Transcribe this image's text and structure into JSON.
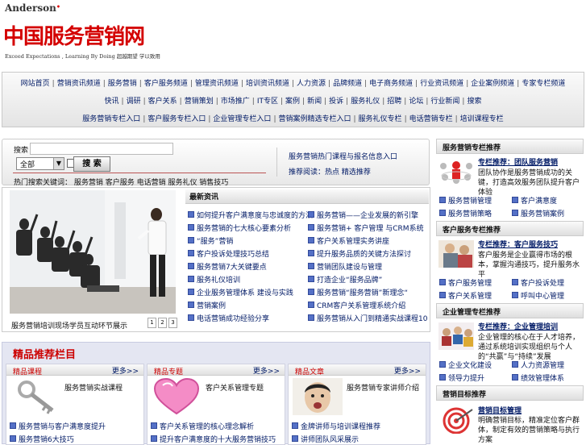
{
  "brand": {
    "en": "Anderson",
    "reg_mark": "•",
    "cn": "中国服务营销网",
    "tagline": "Exceed Expectations , Learning By Doing 超越期望 学以致用"
  },
  "nav": {
    "row1": [
      "网站首页",
      "营销资讯频道",
      "服务营销",
      "客户服务频道",
      "管理资讯频道",
      "培训资讯频道",
      "人力资源",
      "品牌频道",
      "电子商务频道",
      "行业资讯频道",
      "企业案例频道",
      "专家专栏频道"
    ],
    "row2": [
      "快讯",
      "调研",
      "客户关系",
      "营销策划",
      "市场推广",
      "IT专区",
      "案例",
      "新闻",
      "投诉",
      "服务礼仪",
      "招聘",
      "论坛",
      "行业新闻",
      "搜索"
    ],
    "row3": [
      "服务营销专栏入口",
      "客户服务专栏入口",
      "企业管理专栏入口",
      "营销案例精选专栏入口",
      "服务礼仪专栏",
      "电话营销专栏",
      "培训课程专栏"
    ]
  },
  "search": {
    "label": "搜索",
    "input_value": "",
    "select_value": "全部",
    "button": "搜 索",
    "link1": "服务营销热门课程与报名信息入口",
    "link2": "推荐阅读：热点 精选推荐"
  },
  "hot_line": "热门搜索关键词： 服务营销 客户服务 电话营销 服务礼仪 销售技巧",
  "news": {
    "title": "最新资讯",
    "photo_caption": "服务营销培训现场学员互动环节展示",
    "pages": [
      "1",
      "2",
      "3"
    ],
    "left": [
      "如何提升客户满意度与忠诚度的方法",
      "服务营销的七大核心要素分析",
      "“服务”营销",
      "客户投诉处理技巧总结",
      "服务营销7大关键要点",
      "服务礼仪培训",
      "企业服务管理体系 建设与实践",
      "营销案例",
      "电话营销成功经验分享"
    ],
    "right": [
      "服务营销——企业发展的新引擎",
      "服务营销+ 客户管理 与CRM系统",
      "客户关系管理实务讲座",
      "提升服务品质的关键方法探讨",
      "营销团队建设与管理",
      "打造企业“服务品牌”",
      "服务营销“服务营销”新理念“",
      "CRM客户关系管理系统介绍",
      "服务营销从入门到精通实战课程10"
    ]
  },
  "featured": {
    "title": "精品推荐栏目",
    "more": "更多>>",
    "cards": [
      {
        "tag": "精品课程",
        "desc": "服务营销实战课程",
        "l1": "服务营销与客户满意度提升",
        "l2": "服务营销6大技巧"
      },
      {
        "tag": "精品专题",
        "desc": "客户关系管理专题",
        "l1": "客户关系管理的核心理念解析",
        "l2": "提升客户满意度的十大服务营销技巧"
      },
      {
        "tag": "精品文章",
        "desc": "服务营销专家讲师介绍",
        "l1": "金牌讲师与培训课程推荐",
        "l2": "讲师团队风采展示"
      }
    ]
  },
  "right_boxes": [
    {
      "head": "服务营销专栏推荐",
      "title": "专栏推荐：团队服务营销",
      "desc": "团队协作是服务营销成功的关键，打造高效服务团队提升客户体验",
      "links": [
        "服务营销管理",
        "客户满意度",
        "服务营销策略",
        "服务营销案例"
      ]
    },
    {
      "head": "客户服务专栏推荐",
      "title": "专栏推荐：客户服务技巧",
      "desc": "客户服务是企业赢得市场的根本，掌握沟通技巧，提升服务水平",
      "links": [
        "客户服务管理",
        "客户投诉处理",
        "客户关系管理",
        "呼叫中心管理"
      ]
    },
    {
      "head": "企业管理专栏推荐",
      "title": "专栏推荐：企业管理培训",
      "desc": "企业管理的核心在于人才培养，通过系统培训实现组织与个人的“共赢”与“持续”发展",
      "links": [
        "企业文化建设",
        "人力资源管理",
        "领导力提升",
        "绩效管理体系"
      ]
    },
    {
      "head": "营销目标推荐",
      "title": "营销目标管理",
      "desc": "明确营销目标，精准定位客户群体，制定有效的营销策略与执行方案"
    }
  ],
  "colors": {
    "brand_red": "#d40000",
    "link_blue": "#001a66",
    "featured_bg": "#e4e6f2"
  }
}
